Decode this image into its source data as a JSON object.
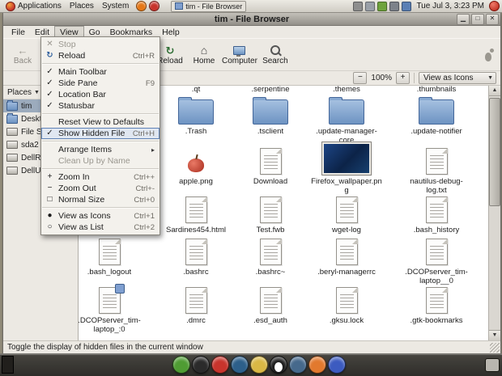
{
  "top_panel": {
    "menus": [
      "Applications",
      "Places",
      "System"
    ],
    "launchers": [
      {
        "name": "firefox-launcher-icon",
        "color": "#e67817"
      },
      {
        "name": "mail-launcher-icon",
        "color": "#c8342c"
      }
    ],
    "window_button": "tim - File Browser",
    "tray": [
      {
        "name": "notification-icon",
        "color": "#8e8e8e"
      },
      {
        "name": "network-icon",
        "color": "#9aa0a8"
      },
      {
        "name": "battery-icon",
        "color": "#6fa33c"
      },
      {
        "name": "volume-icon",
        "color": "#7d828a"
      },
      {
        "name": "keyboard-indicator-icon",
        "color": "#5a7fb4"
      }
    ],
    "clock": "Tue Jul 3, 3:23 PM"
  },
  "window": {
    "title": "tim - File Browser",
    "menubar": [
      "File",
      "Edit",
      "View",
      "Go",
      "Bookmarks",
      "Help"
    ],
    "open_menu": "View",
    "toolbar": [
      {
        "name": "back-button",
        "label": "Back",
        "icon": "back-icon",
        "disabled": true
      },
      {
        "name": "reload-button",
        "label": "Reload",
        "icon": "reload-icon",
        "disabled": false
      },
      {
        "name": "home-button",
        "label": "Home",
        "icon": "home-icon",
        "disabled": false
      },
      {
        "name": "computer-button",
        "label": "Computer",
        "icon": "computer-icon",
        "disabled": false
      },
      {
        "name": "search-button",
        "label": "Search",
        "icon": "search-icon",
        "disabled": false
      }
    ],
    "zoom": {
      "out": "−",
      "level": "100%",
      "in": "+",
      "view_mode": "View as Icons"
    },
    "side_pane": {
      "header": "Places",
      "items": [
        {
          "label": "tim",
          "icon": "folder",
          "selected": true
        },
        {
          "label": "Desktop",
          "icon": "folder",
          "selected": false
        },
        {
          "label": "File System",
          "icon": "drive",
          "selected": false
        },
        {
          "label": "sda2",
          "icon": "drive",
          "selected": false
        },
        {
          "label": "DellRes...",
          "icon": "drive",
          "selected": false
        },
        {
          "label": "DellUtili...",
          "icon": "drive",
          "selected": false
        }
      ]
    },
    "statusbar": "Toggle the display of hidden files in the current window"
  },
  "view_menu": {
    "items": [
      {
        "label": "Stop",
        "icon": "stop-icon",
        "disabled": true
      },
      {
        "label": "Reload",
        "icon": "reload-icon",
        "accel": "Ctrl+R"
      },
      {
        "type": "sep"
      },
      {
        "label": "Main Toolbar",
        "check": true
      },
      {
        "label": "Side Pane",
        "check": true,
        "accel": "F9"
      },
      {
        "label": "Location Bar",
        "check": true
      },
      {
        "label": "Statusbar",
        "check": true
      },
      {
        "type": "sep"
      },
      {
        "label": "Reset View to Defaults"
      },
      {
        "label": "Show Hidden Files",
        "check": true,
        "accel": "Ctrl+H",
        "highlight": true
      },
      {
        "type": "sep"
      },
      {
        "label": "Arrange Items",
        "submenu": true
      },
      {
        "label": "Clean Up by Name",
        "disabled": true
      },
      {
        "type": "sep"
      },
      {
        "label": "Zoom In",
        "icon": "zoom-in-icon",
        "accel": "Ctrl++"
      },
      {
        "label": "Zoom Out",
        "icon": "zoom-out-icon",
        "accel": "Ctrl+-"
      },
      {
        "label": "Normal Size",
        "icon": "normal-size-icon",
        "accel": "Ctrl+0"
      },
      {
        "type": "sep"
      },
      {
        "label": "View as Icons",
        "radio": "on",
        "accel": "Ctrl+1"
      },
      {
        "label": "View as List",
        "radio": "off",
        "accel": "Ctrl+2"
      }
    ]
  },
  "file_grid": {
    "rows": [
      [
        null,
        {
          "name": ".qt",
          "type": "cut"
        },
        {
          "name": ".serpentine",
          "type": "cut"
        },
        {
          "name": ".themes",
          "type": "cut"
        },
        {
          "name": ".thumbnails",
          "type": "cut"
        }
      ],
      [
        null,
        {
          "name": ".Trash",
          "type": "folder"
        },
        {
          "name": ".tsclient",
          "type": "folder"
        },
        {
          "name": ".update-manager-core",
          "type": "folder"
        },
        {
          "name": ".update-notifier",
          "type": "folder"
        }
      ],
      [
        null,
        {
          "name": "apple.png",
          "type": "image-apple"
        },
        {
          "name": "Download",
          "type": "doc"
        },
        {
          "name": "Firefox_wallpaper.png",
          "type": "image-blue"
        },
        {
          "name": "nautilus-debug-log.txt",
          "type": "doc"
        }
      ],
      [
        null,
        {
          "name": "Sardines454.html",
          "type": "doc"
        },
        {
          "name": "Test.fwb",
          "type": "doc"
        },
        {
          "name": "wget-log",
          "type": "doc"
        },
        {
          "name": ".bash_history",
          "type": "doc"
        }
      ],
      [
        {
          "name": ".bash_logout",
          "type": "doc"
        },
        {
          "name": ".bashrc",
          "type": "doc"
        },
        {
          "name": ".bashrc~",
          "type": "doc"
        },
        {
          "name": ".beryl-managerrc",
          "type": "doc"
        },
        {
          "name": ".DCOPserver_tim-laptop__0",
          "type": "doc"
        }
      ],
      [
        {
          "name": ".DCOPserver_tim-laptop_:0",
          "type": "doc-badge"
        },
        {
          "name": ".dmrc",
          "type": "doc"
        },
        {
          "name": ".esd_auth",
          "type": "doc"
        },
        {
          "name": ".gksu.lock",
          "type": "doc"
        },
        {
          "name": ".gtk-bookmarks",
          "type": "doc"
        }
      ]
    ]
  },
  "bottom_panel": {
    "show_desktop": {
      "name": "show-desktop-icon",
      "color": "#211f1c"
    },
    "dock": [
      {
        "name": "launcher-green-icon",
        "color": "#4f9c33"
      },
      {
        "name": "terminal-icon",
        "color": "#2b2b2b"
      },
      {
        "name": "ubuntu-icon",
        "color": "#c8342c"
      },
      {
        "name": "globe-icon",
        "color": "#2d5f8a"
      },
      {
        "name": "emblem-star-icon",
        "color": "#d9b845"
      },
      {
        "name": "tux-icon",
        "color": "#1f1f1f"
      },
      {
        "name": "bluefish-icon",
        "color": "#46698c"
      },
      {
        "name": "firefox-icon",
        "color": "#e2792e"
      },
      {
        "name": "konqueror-icon",
        "color": "#3c5bc0"
      }
    ],
    "corner": {
      "name": "trash-applet-icon",
      "color": "#b9b6af"
    }
  }
}
